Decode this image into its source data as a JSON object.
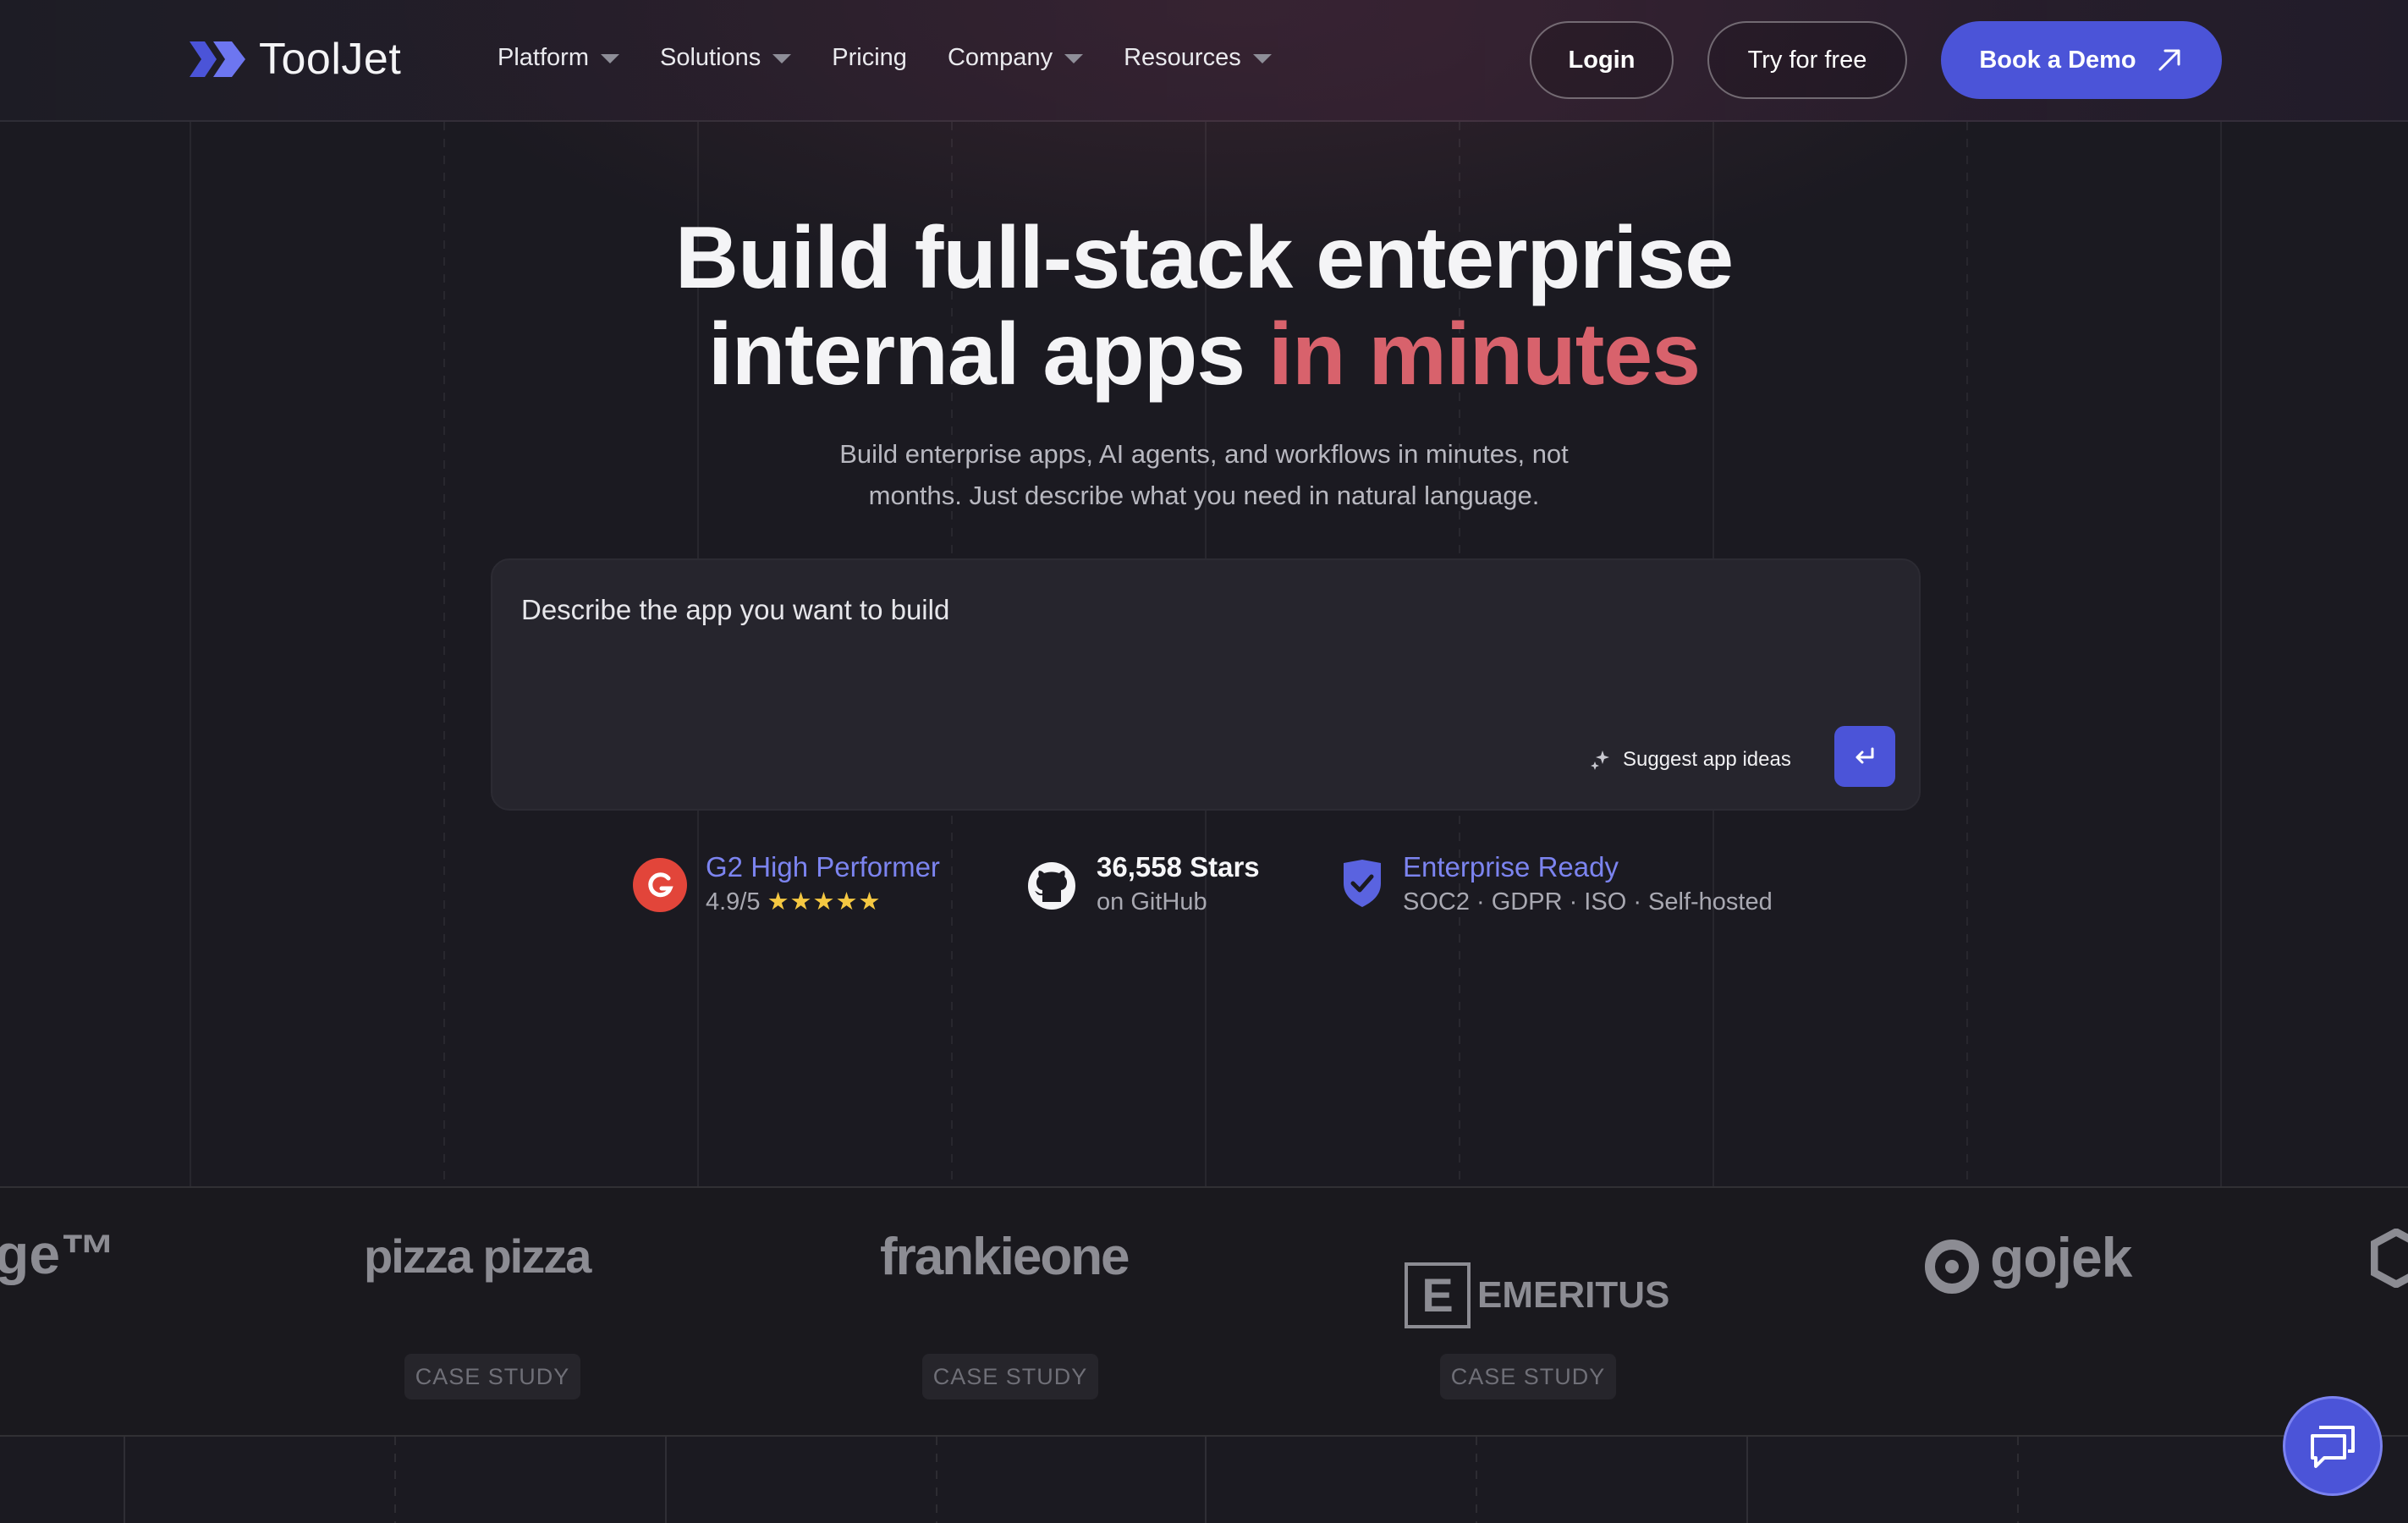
{
  "brand": {
    "name": "ToolJet",
    "accent_color": "#4b54d8",
    "highlight_color": "#d8626c"
  },
  "nav": {
    "menu": [
      {
        "label": "Platform",
        "dropdown": true
      },
      {
        "label": "Solutions",
        "dropdown": true
      },
      {
        "label": "Pricing",
        "dropdown": false
      },
      {
        "label": "Company",
        "dropdown": true
      },
      {
        "label": "Resources",
        "dropdown": true
      }
    ],
    "login_label": "Login",
    "try_label": "Try for free",
    "demo_label": "Book a Demo"
  },
  "hero": {
    "title_line1": "Build full-stack enterprise",
    "title_line2_a": "internal apps",
    "title_line2_b": "in minutes",
    "subtitle_line1": "Build enterprise apps, AI agents, and workflows in minutes, not",
    "subtitle_line2": "months. Just describe what you need in natural language."
  },
  "prompt": {
    "placeholder": "Describe the app you want to build",
    "suggest_label": "Suggest app ideas",
    "send_icon": "enter-icon"
  },
  "badges": [
    {
      "title": "G2 High Performer",
      "sub": "4.9/5",
      "stars": "★★★★★",
      "icon": "g2-icon"
    },
    {
      "title": "36,558 Stars",
      "sub": "on GitHub",
      "icon": "github-icon"
    },
    {
      "title": "Enterprise Ready",
      "sub": "SOC2 · GDPR · ISO · Self-hosted",
      "icon": "shield-check-icon"
    }
  ],
  "customers": [
    {
      "name": "ge™"
    },
    {
      "name": "pizza pizza",
      "case": "CASE STUDY"
    },
    {
      "name": "frankieone",
      "case": "CASE STUDY"
    },
    {
      "name": "EMERITUS",
      "mark": "E",
      "case": "CASE STUDY"
    },
    {
      "name": "gojek"
    }
  ],
  "chat_icon": "chat-bubble-icon"
}
